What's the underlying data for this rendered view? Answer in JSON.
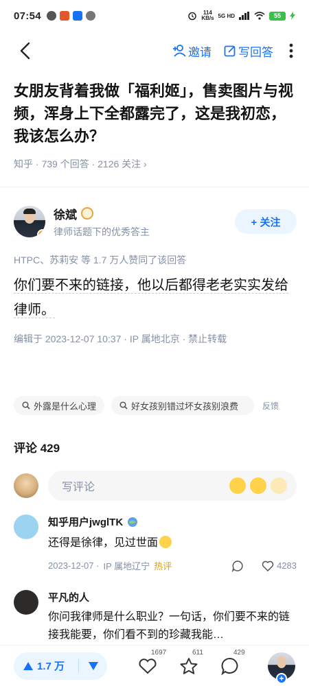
{
  "status_bar": {
    "time": "07:54",
    "net_speed_value": "114",
    "net_speed_unit": "KB/s",
    "network": "5G HD",
    "battery": "55"
  },
  "nav": {
    "invite_label": "邀请",
    "write_answer_label": "写回答"
  },
  "question": {
    "title": "女朋友背着我做「福利姬」，售卖图片与视频，浑身上下全都露完了，这是我初恋，我该怎么办？",
    "meta": "知乎 · 739 个回答 · 2126 关注 ›"
  },
  "author": {
    "name": "徐斌",
    "description": "律师话题下的优秀答主",
    "follow_label": "+ 关注"
  },
  "answer": {
    "voters": "HTPC、苏莉安 等 1.7 万人赞同了该回答",
    "text": "你们要不来的链接，他以后都得老老实实发给律师。",
    "edit_info": "编辑于 2023-12-07 10:37 · IP 属地北京 · 禁止转载"
  },
  "tags": [
    {
      "label": "外露是什么心理"
    },
    {
      "label": "好女孩别错过坏女孩别浪费"
    }
  ],
  "feedback_label": "反馈",
  "comments": {
    "header": "评论 429",
    "input_placeholder": "写评论",
    "items": [
      {
        "name": "知乎用户jwglTK",
        "text": "还得是徐律，见过世面",
        "date": "2023-12-07 ·",
        "ip": "IP 属地辽宁",
        "hot": "热评",
        "likes": "4283"
      },
      {
        "name": "平凡的人",
        "text": "你问我律师是什么职业？一句话，你们要不来的链接我能要，你们看不到的珍藏我能…"
      }
    ]
  },
  "bottom_bar": {
    "vote_count": "1.7 万",
    "like_count": "1697",
    "collect_count": "611",
    "comment_count": "429"
  },
  "colors": {
    "brand_blue": "#1772f6",
    "meta_gray": "#8590a6",
    "hot_yellow": "#e0a100"
  }
}
